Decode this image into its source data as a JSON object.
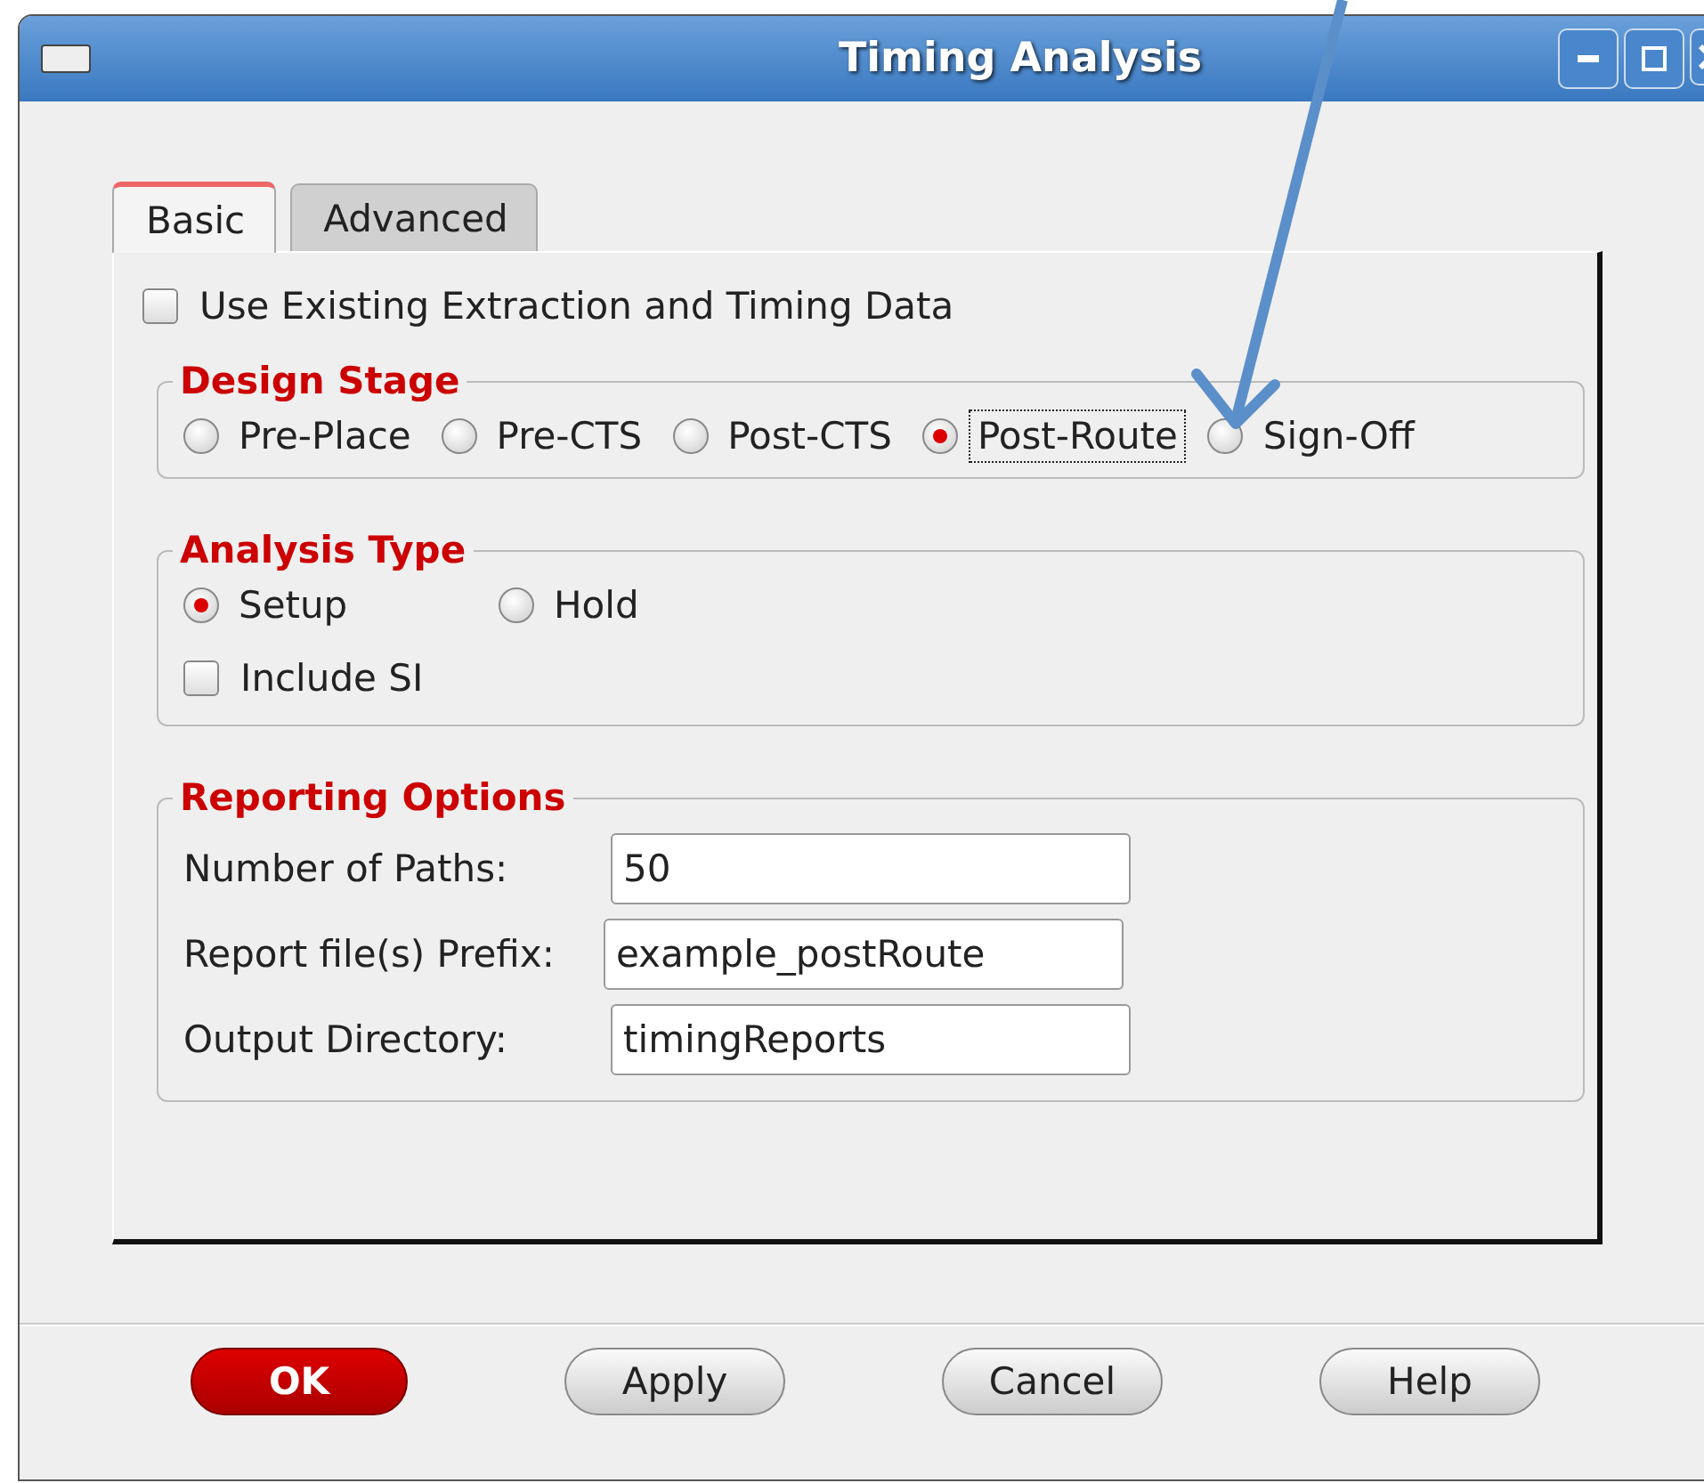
{
  "window": {
    "title": "Timing Analysis"
  },
  "tabs": [
    {
      "label": "Basic",
      "selected": true
    },
    {
      "label": "Advanced",
      "selected": false
    }
  ],
  "use_existing": {
    "label": "Use Existing Extraction and Timing Data",
    "checked": false
  },
  "design_stage": {
    "title": "Design Stage",
    "options": [
      {
        "label": "Pre-Place",
        "selected": false,
        "focused": false
      },
      {
        "label": "Pre-CTS",
        "selected": false,
        "focused": false
      },
      {
        "label": "Post-CTS",
        "selected": false,
        "focused": false
      },
      {
        "label": "Post-Route",
        "selected": true,
        "focused": true
      },
      {
        "label": "Sign-Off",
        "selected": false,
        "focused": false
      }
    ]
  },
  "analysis_type": {
    "title": "Analysis Type",
    "options": [
      {
        "label": "Setup",
        "selected": true
      },
      {
        "label": "Hold",
        "selected": false
      }
    ],
    "include_si": {
      "label": "Include SI",
      "checked": false
    }
  },
  "reporting_options": {
    "title": "Reporting Options",
    "fields": [
      {
        "label": "Number of Paths:",
        "value": "50"
      },
      {
        "label": "Report file(s) Prefix:",
        "value": "example_postRoute"
      },
      {
        "label": "Output Directory:",
        "value": "timingReports"
      }
    ]
  },
  "buttons": [
    {
      "label": "OK",
      "kind": "primary"
    },
    {
      "label": "Apply",
      "kind": "normal"
    },
    {
      "label": "Cancel",
      "kind": "normal"
    },
    {
      "label": "Help",
      "kind": "normal"
    }
  ]
}
